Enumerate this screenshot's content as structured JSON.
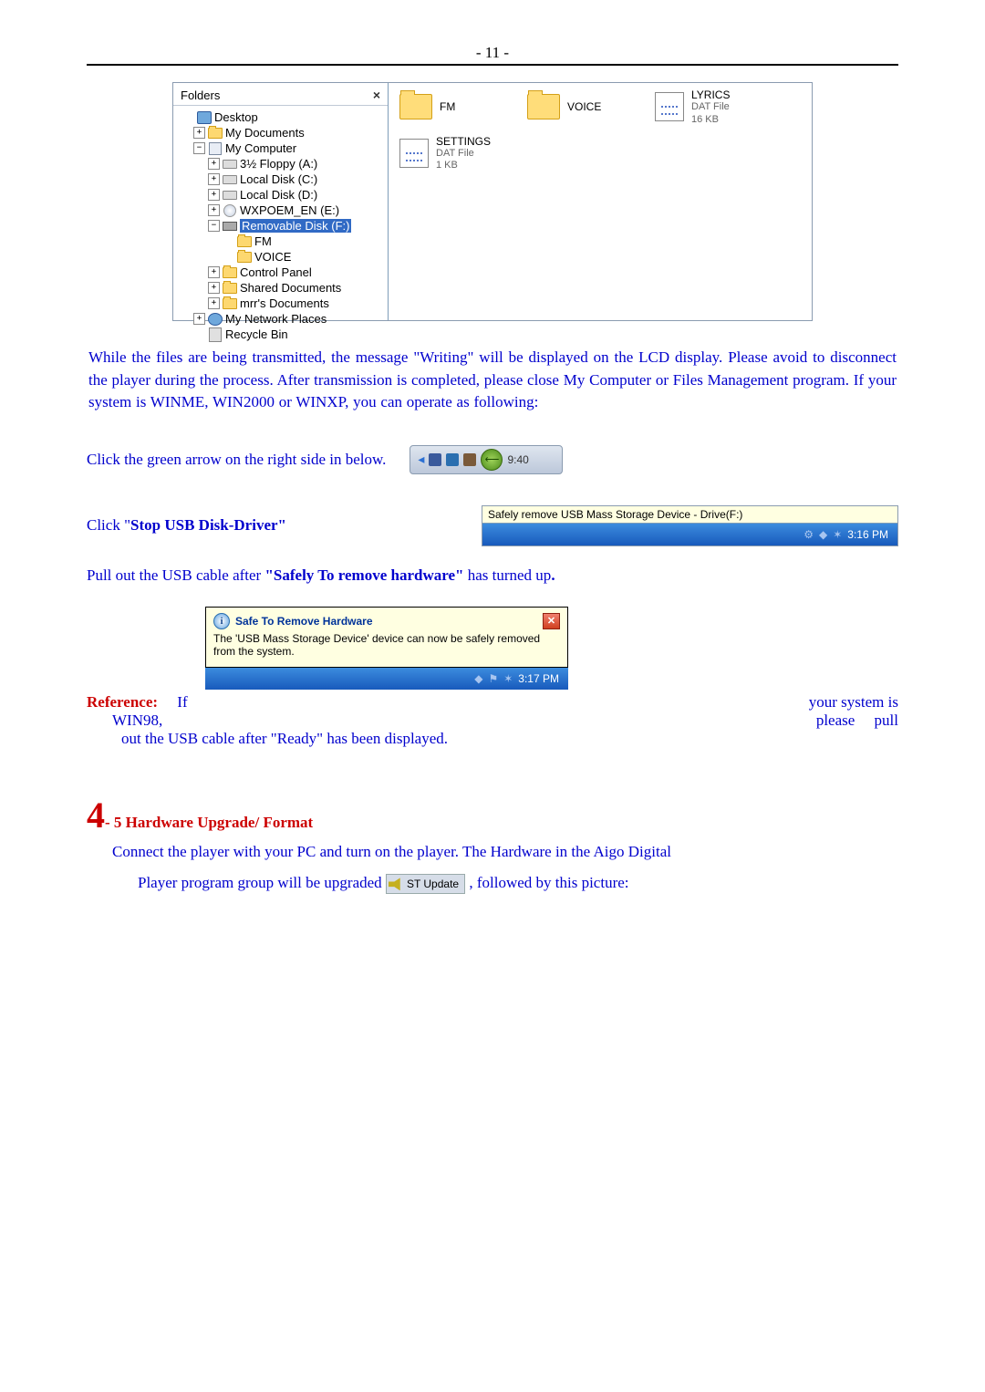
{
  "header": {
    "page_number": "- 11 -"
  },
  "explorer": {
    "pane_title": "Folders",
    "close": "×",
    "tree": {
      "desktop": "Desktop",
      "my_documents": "My Documents",
      "my_computer": "My Computer",
      "floppy": "3½ Floppy (A:)",
      "local_c": "Local Disk (C:)",
      "local_d": "Local Disk (D:)",
      "wxpoem": "WXPOEM_EN (E:)",
      "removable": "Removable Disk (F:)",
      "fm": "FM",
      "voice": "VOICE",
      "control_panel": "Control Panel",
      "shared_docs": "Shared Documents",
      "mrr_docs": "mrr's Documents",
      "network": "My Network Places",
      "recycle": "Recycle Bin"
    },
    "right": {
      "fm": "FM",
      "voice": "VOICE",
      "lyrics": "LYRICS",
      "lyrics_type": "DAT File",
      "lyrics_size": "16 KB",
      "settings": "SETTINGS",
      "settings_type": "DAT File",
      "settings_size": "1 KB"
    }
  },
  "para1": "While the files are being transmitted, the message \"Writing\" will be displayed on the LCD display. Please avoid to disconnect the player during the process. After transmission is completed, please close My Computer or Files Management program. If your system is WINME, WIN2000 or WINXP, you can operate as following:",
  "click_green": "Click the green arrow on the right side in below.",
  "tray": {
    "time1": "9:40"
  },
  "click_stop_prefix": "Click \"",
  "click_stop_bold": "Stop USB Disk-Driver\"",
  "safely_tooltip": "Safely remove USB Mass Storage Device - Drive(F:)",
  "taskbar_time2": "3:16 PM",
  "pullout_prefix": "Pull out the USB cable after ",
  "pullout_bold": "\"Safely To remove hardware\"",
  "pullout_suffix": " has turned up",
  "balloon": {
    "title": "Safe To Remove Hardware",
    "body": "The 'USB Mass Storage Device' device can now be safely removed from the system.",
    "time": "3:17 PM"
  },
  "reference_label": "Reference:",
  "reference_if": "If",
  "reference_tail": "your system is",
  "win98_left": "WIN98,",
  "win98_right_please": "please",
  "win98_right_pull": "pull",
  "win98_line2": "out the USB cable after \"Ready\" has been displayed.",
  "section": {
    "big": "4",
    "rest": "- 5 Hardware Upgrade/ Format"
  },
  "connect_line1": "Connect the player with your PC and turn on the player. The Hardware in the Aigo Digital",
  "connect_line2a": "Player program group will be upgraded ",
  "st_update": "ST Update",
  "connect_line2b": ", followed by this picture:"
}
